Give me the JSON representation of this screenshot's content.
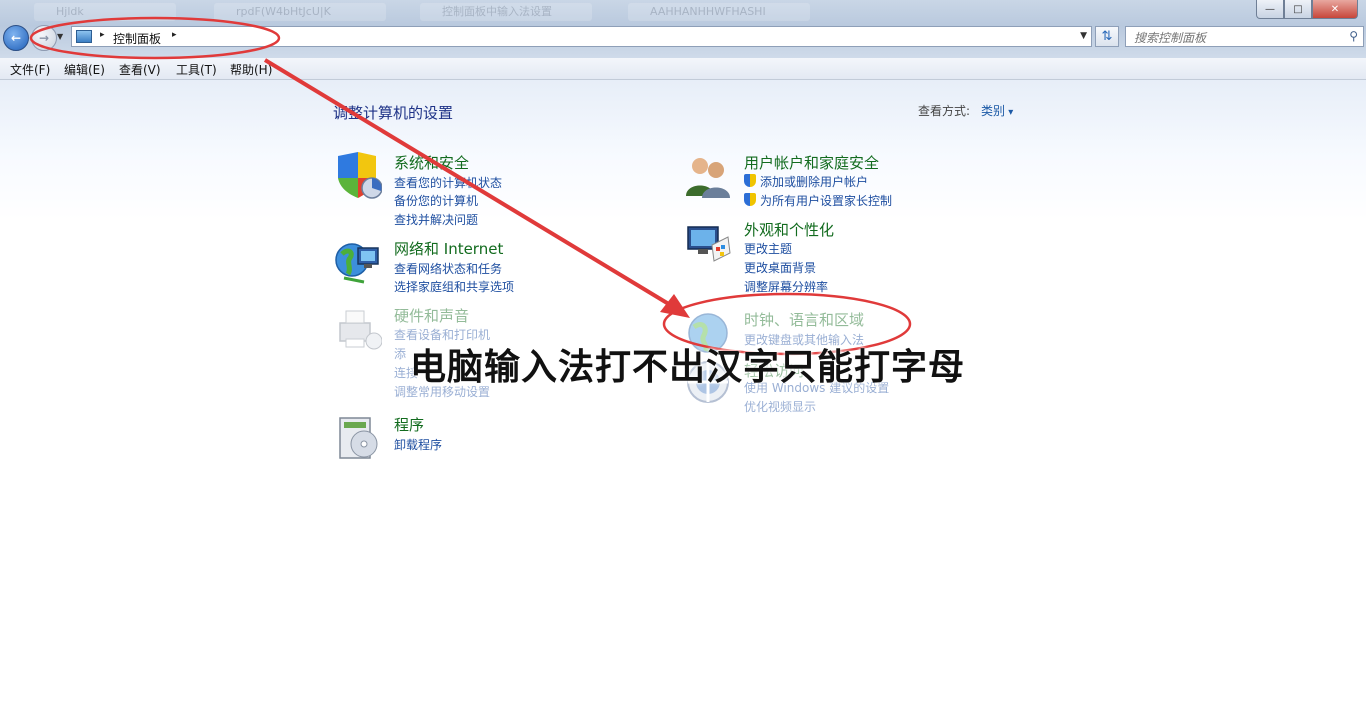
{
  "window": {
    "ghost_tabs": [
      "Hjldk",
      "rpdF(W4bHtJcU|K",
      "控制面板中输入法设置",
      "AAHHANHHWFHASHI"
    ],
    "controls": {
      "minimize": "—",
      "maximize": "□",
      "close": "✕"
    }
  },
  "address_bar": {
    "crumb": "控制面板",
    "sep": "▸"
  },
  "search": {
    "placeholder": "搜索控制面板"
  },
  "menu": {
    "file": "文件(F)",
    "edit": "编辑(E)",
    "view": "查看(V)",
    "tools": "工具(T)",
    "help": "帮助(H)"
  },
  "main": {
    "heading": "调整计算机的设置",
    "view_by_label": "查看方式:",
    "view_by_value": "类别"
  },
  "categories": {
    "system": {
      "title": "系统和安全",
      "links": [
        "查看您的计算机状态",
        "备份您的计算机",
        "查找并解决问题"
      ]
    },
    "network": {
      "title": "网络和 Internet",
      "links": [
        "查看网络状态和任务",
        "选择家庭组和共享选项"
      ]
    },
    "hardware": {
      "title": "硬件和声音",
      "links": [
        "查看设备和打印机",
        "添",
        "连接",
        "调整常用移动设置"
      ]
    },
    "programs": {
      "title": "程序",
      "links": [
        "卸载程序"
      ]
    },
    "users": {
      "title": "用户帐户和家庭安全",
      "links": [
        "添加或删除用户帐户",
        "为所有用户设置家长控制"
      ]
    },
    "appearance": {
      "title": "外观和个性化",
      "links": [
        "更改主题",
        "更改桌面背景",
        "调整屏幕分辨率"
      ]
    },
    "clock": {
      "title": "时钟、语言和区域",
      "links": [
        "更改键盘或其他输入法"
      ]
    },
    "ease": {
      "title": "轻松访问",
      "links": [
        "使用 Windows 建议的设置",
        "优化视频显示"
      ]
    }
  },
  "overlay": {
    "banner": "电脑输入法打不出汉字只能打字母",
    "annotation_color": "#e03a3a"
  }
}
